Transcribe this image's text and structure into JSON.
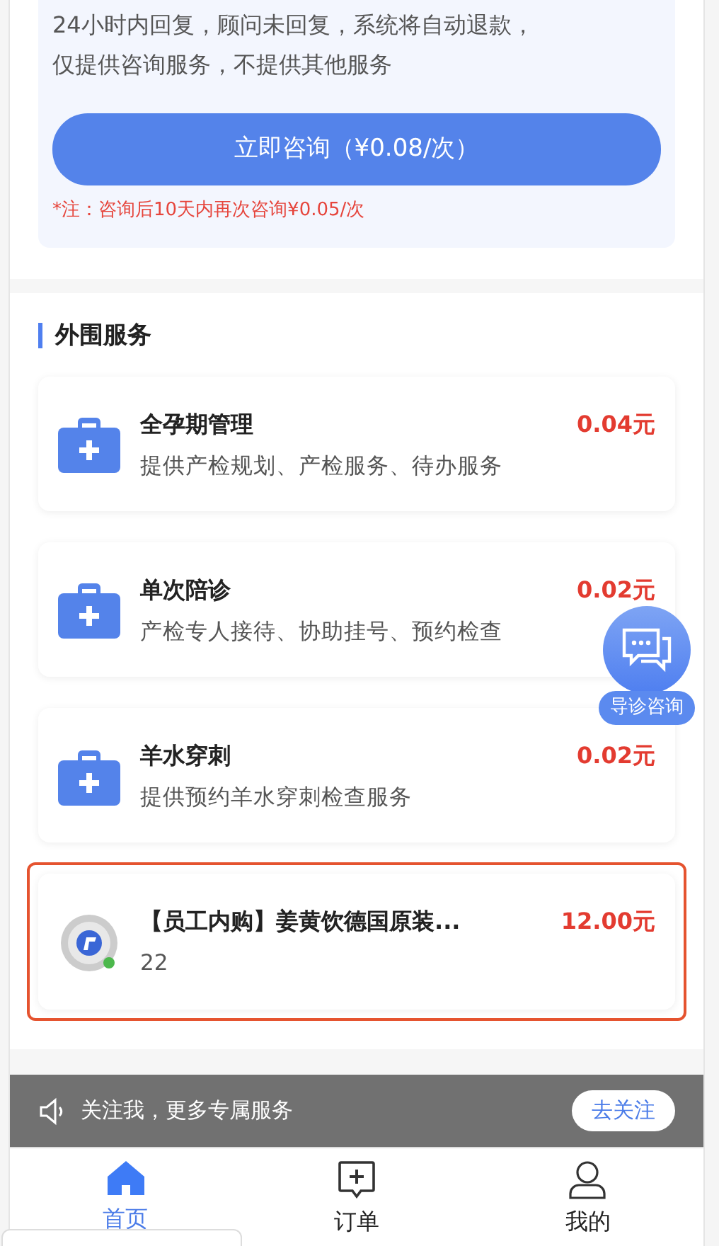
{
  "consult": {
    "notice_lines": [
      "24小时内回复，顾问未回复，系统将自动退款，",
      "仅提供咨询服务，不提供其他服务"
    ],
    "button": "立即咨询（¥0.08/次）",
    "note": "*注：咨询后10天内再次咨询¥0.05/次"
  },
  "section": {
    "title": "外围服务",
    "items": [
      {
        "kind": "service",
        "title": "全孕期管理",
        "desc": "提供产检规划、产检服务、待办服务",
        "price": "0.04元",
        "highlighted": false
      },
      {
        "kind": "service",
        "title": "单次陪诊",
        "desc": "产检专人接待、协助挂号、预约检查",
        "price": "0.02元",
        "highlighted": false
      },
      {
        "kind": "service",
        "title": "羊水穿刺",
        "desc": "提供预约羊水穿刺检查服务",
        "price": "0.02元",
        "highlighted": false
      },
      {
        "kind": "product",
        "title": "【员工内购】姜黄饮德国原装...",
        "desc": "22",
        "price": "12.00元",
        "highlighted": true
      }
    ]
  },
  "float_button": {
    "label": "导诊咨询"
  },
  "follow_bar": {
    "text": "关注我，更多专属服务",
    "button": "去关注"
  },
  "tabs": [
    {
      "label": "首页",
      "selected": true
    },
    {
      "label": "订单",
      "selected": false
    },
    {
      "label": "我的",
      "selected": false
    }
  ]
}
